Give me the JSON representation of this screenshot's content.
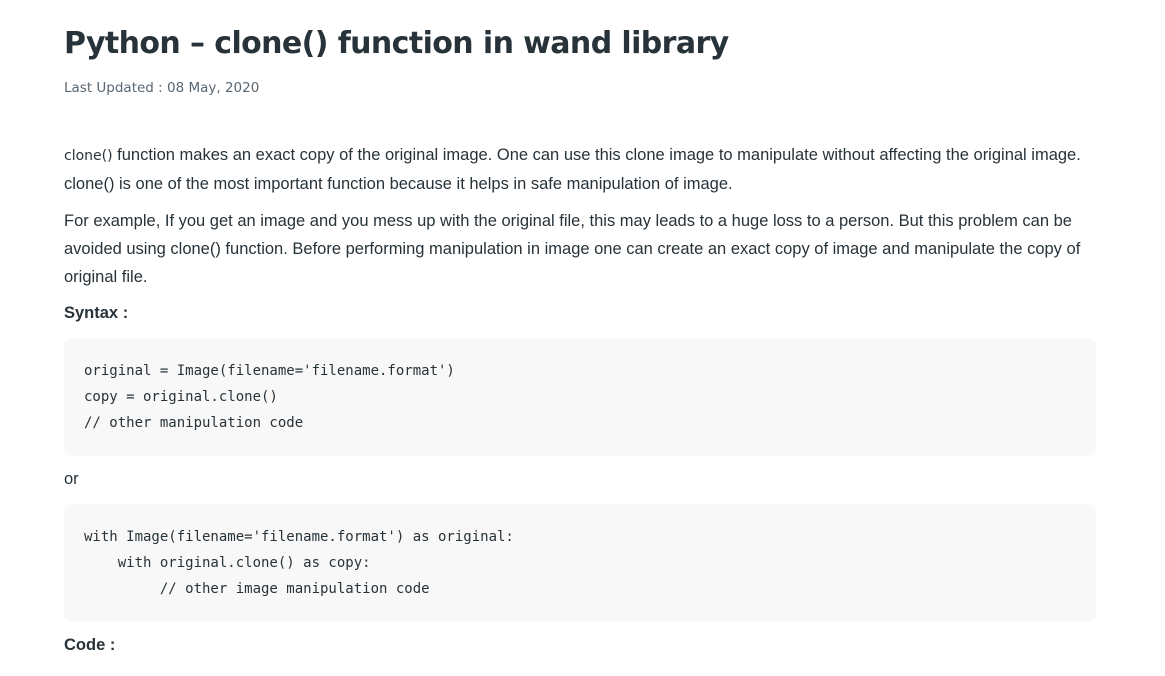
{
  "article": {
    "title": "Python – clone() function in wand library",
    "last_updated": "Last Updated : 08 May, 2020",
    "para1": {
      "lead": "clone()",
      "rest": " function makes an exact copy of the original image. One can use this clone image to manipulate without affecting the original image. clone() is one of the most important function because it helps in safe manipulation of image."
    },
    "para2": "For example, If you get an image and you mess up with the original file, this may leads to a huge loss to a person. But this problem can be avoided using clone() function. Before performing manipulation in image one can create an exact copy of image and manipulate the copy of original file.",
    "syntax_label": "Syntax :",
    "syntax_code_1": [
      "original = Image(filename='filename.format')",
      "copy = original.clone()",
      "// other manipulation code"
    ],
    "or_text": "or",
    "syntax_code_2": [
      "with Image(filename='filename.format') as original:",
      "    with original.clone() as copy:",
      "         // other image manipulation code"
    ],
    "code_label": "Code :"
  }
}
